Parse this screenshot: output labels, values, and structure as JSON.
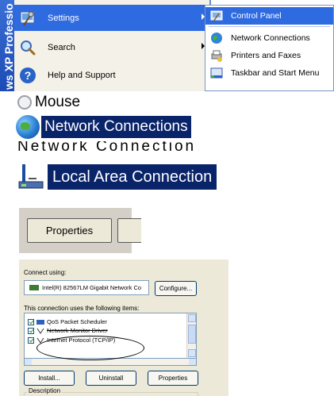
{
  "start_menu": {
    "os_stripe_text": "ws XP Professio",
    "items": [
      {
        "label": "Settings",
        "icon": "settings-icon",
        "has_submenu": true,
        "active": true
      },
      {
        "label": "Search",
        "icon": "search-icon",
        "has_submenu": true,
        "active": false
      },
      {
        "label": "Help and Support",
        "icon": "help-icon",
        "has_submenu": false,
        "active": false
      }
    ],
    "settings_submenu": [
      {
        "label": "Control Panel",
        "icon": "control-panel-icon",
        "active": true
      },
      {
        "label": "Network Connections",
        "icon": "network-connections-icon",
        "active": false
      },
      {
        "label": "Printers and Faxes",
        "icon": "printer-icon",
        "active": false
      },
      {
        "label": "Taskbar and Start Menu",
        "icon": "taskbar-icon",
        "active": false
      }
    ]
  },
  "control_panel_list": {
    "mouse_label": "Mouse",
    "network_connections_label": "Network Connections",
    "cut_item_label": "Network Connection Wizard"
  },
  "network_connections": {
    "local_area_connection_label": "Local Area Connection"
  },
  "context_step": {
    "properties_button_label": "Properties"
  },
  "properties_dialog": {
    "connect_using_label": "Connect using:",
    "adapter_name": "Intel(R) 82567LM Gigabit Network Co",
    "configure_label": "Configure...",
    "uses_items_label": "This connection uses the following items:",
    "items": [
      {
        "label": "QoS Packet Scheduler",
        "checked": true,
        "strike": false
      },
      {
        "label": "Network Monitor Driver",
        "checked": true,
        "strike": true
      },
      {
        "label": "Internet Protocol (TCP/IP)",
        "checked": true,
        "strike": false
      }
    ],
    "install_label": "Install...",
    "uninstall_label": "Uninstall",
    "properties_label": "Properties",
    "description_label": "Description"
  },
  "colors": {
    "xp_blue": "#2f6be0",
    "selection_navy": "#0a246a",
    "dialog_bg": "#ece9d8"
  }
}
